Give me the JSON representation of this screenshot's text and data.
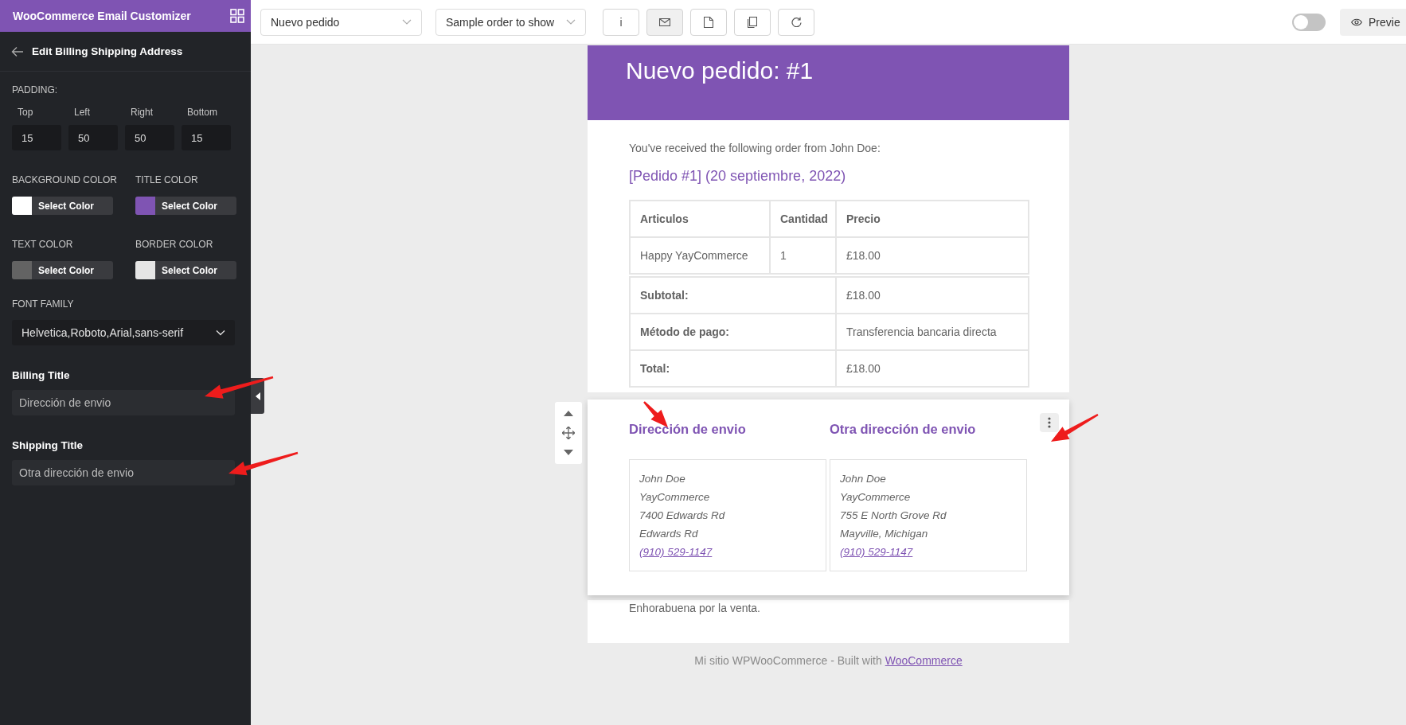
{
  "sidebar": {
    "app_title": "WooCommerce Email Customizer",
    "panel_title": "Edit Billing Shipping Address",
    "padding": {
      "label": "PADDING:",
      "fields": [
        {
          "label": "Top",
          "value": "15"
        },
        {
          "label": "Left",
          "value": "50"
        },
        {
          "label": "Right",
          "value": "50"
        },
        {
          "label": "Bottom",
          "value": "15"
        }
      ]
    },
    "colors": [
      {
        "label": "BACKGROUND COLOR",
        "button": "Select Color",
        "color": "#ffffff"
      },
      {
        "label": "TITLE COLOR",
        "button": "Select Color",
        "color": "#7f54b3"
      },
      {
        "label": "TEXT COLOR",
        "button": "Select Color",
        "color": "#636363"
      },
      {
        "label": "BORDER COLOR",
        "button": "Select Color",
        "color": "#e5e5e5"
      }
    ],
    "font_family": {
      "label": "FONT FAMILY",
      "value": "Helvetica,Roboto,Arial,sans-serif"
    },
    "text_fields": [
      {
        "label": "Billing Title",
        "value": "Dirección de envio"
      },
      {
        "label": "Shipping Title",
        "value": "Otra dirección de envio"
      }
    ]
  },
  "toolbar": {
    "selects": [
      {
        "value": "Nuevo pedido"
      },
      {
        "value": "Sample order to show"
      }
    ],
    "icon_buttons": [
      {
        "kind": "info",
        "label": "i",
        "selected": false
      },
      {
        "kind": "mail",
        "selected": true
      },
      {
        "kind": "document",
        "selected": false
      },
      {
        "kind": "copy",
        "selected": false
      },
      {
        "kind": "reset",
        "selected": false
      }
    ],
    "toggle": {
      "on": false
    },
    "preview_button": "Previe"
  },
  "email": {
    "header_title": "Nuevo pedido: #1",
    "intro": "You've received the following order from John Doe:",
    "order_title": "[Pedido #1] (20 septiembre, 2022)",
    "table": {
      "columns": [
        "Articulos",
        "Cantidad",
        "Precio"
      ],
      "rows": [
        [
          "Happy YayCommerce",
          "1",
          "£18.00"
        ]
      ],
      "totals": [
        {
          "label": "Subtotal:",
          "value": "£18.00"
        },
        {
          "label": "Método de pago:",
          "value": "Transferencia bancaria directa"
        },
        {
          "label": "Total:",
          "value": "£18.00"
        }
      ]
    },
    "addresses": [
      {
        "title": "Dirección de envio",
        "lines": [
          "John Doe",
          "YayCommerce",
          "7400 Edwards Rd",
          "Edwards Rd"
        ],
        "phone": "(910) 529-1147"
      },
      {
        "title": "Otra dirección de envio",
        "lines": [
          "John Doe",
          "YayCommerce",
          "755 E North Grove Rd",
          "Mayville, Michigan"
        ],
        "phone": "(910) 529-1147"
      }
    ],
    "closing": "Enhorabuena por la venta.",
    "footer": {
      "text": "Mi sitio WPWooCommerce - Built with",
      "link": "WooCommerce"
    }
  }
}
